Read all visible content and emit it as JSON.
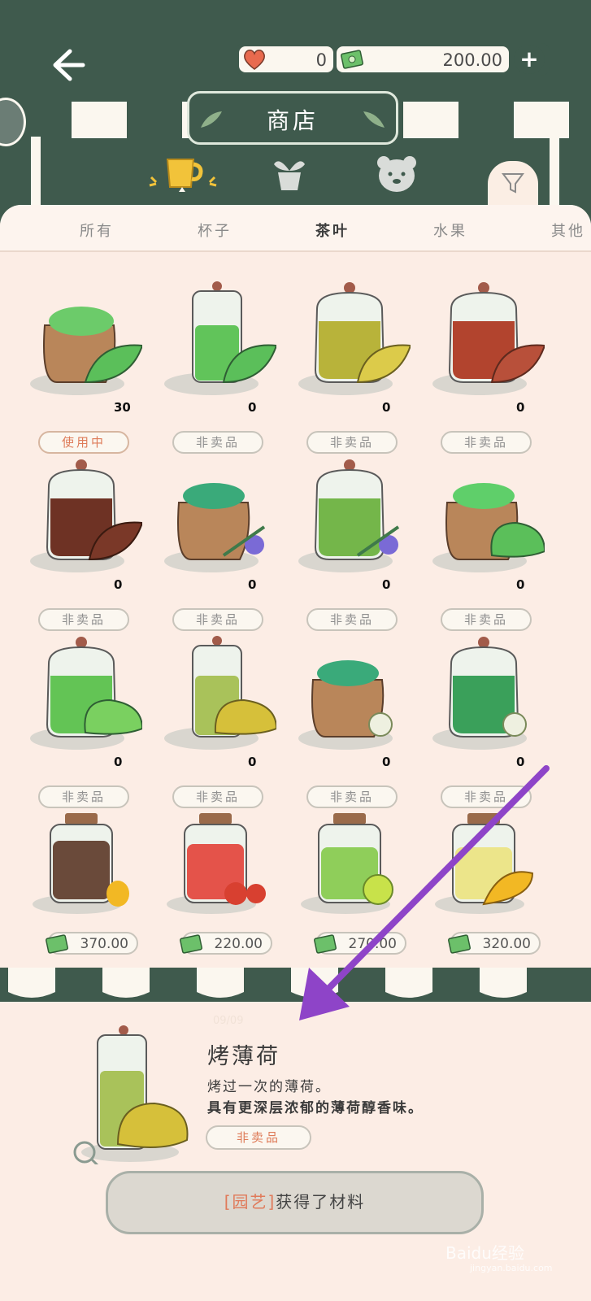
{
  "header": {
    "hearts": "0",
    "money": "200.00",
    "title": "商店"
  },
  "tabs": [
    {
      "label": "所有",
      "active": false
    },
    {
      "label": "杯子",
      "active": false
    },
    {
      "label": "茶叶",
      "active": true
    },
    {
      "label": "水果",
      "active": false
    },
    {
      "label": "其他",
      "active": false
    }
  ],
  "items": [
    {
      "count": "30",
      "status": "使用中"
    },
    {
      "count": "0",
      "status": "非卖品"
    },
    {
      "count": "0",
      "status": "非卖品"
    },
    {
      "count": "0",
      "status": "非卖品"
    },
    {
      "count": "0",
      "status": "非卖品"
    },
    {
      "count": "0",
      "status": "非卖品"
    },
    {
      "count": "0",
      "status": "非卖品"
    },
    {
      "count": "0",
      "status": "非卖品"
    },
    {
      "count": "0",
      "status": "非卖品"
    },
    {
      "count": "0",
      "status": "非卖品"
    },
    {
      "count": "0",
      "status": "非卖品"
    },
    {
      "count": "0",
      "status": "非卖品"
    },
    {
      "price": "370.00"
    },
    {
      "price": "220.00"
    },
    {
      "price": "270.00"
    },
    {
      "price": "320.00"
    }
  ],
  "detail": {
    "ghost_text": "09/09",
    "name": "烤薄荷",
    "desc1": "烤过一次的薄荷。",
    "desc2": "具有更深层浓郁的薄荷醇香味。",
    "status": "非卖品"
  },
  "message": {
    "tag": "[园艺]",
    "text": "获得了材料"
  },
  "watermark": {
    "main": "Baidu经验",
    "sub": "jingyan.baidu.com"
  },
  "colors": {
    "dark_green": "#3f5a4d",
    "panel": "#fcede5",
    "accent_orange": "#de7b58",
    "arrow_purple": "#8e44c8"
  }
}
